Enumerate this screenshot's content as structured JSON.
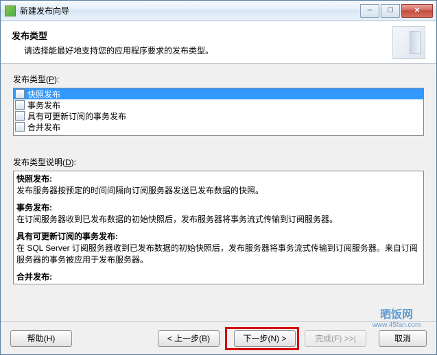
{
  "window": {
    "title": "新建发布向导"
  },
  "banner": {
    "title": "发布类型",
    "subtitle": "请选择能最好地支持您的应用程序要求的发布类型。"
  },
  "types": {
    "label_pre": "发布类型(",
    "label_acc": "P",
    "label_post": "):",
    "items": [
      {
        "label": "快照发布",
        "selected": true
      },
      {
        "label": "事务发布",
        "selected": false
      },
      {
        "label": "具有可更新订阅的事务发布",
        "selected": false
      },
      {
        "label": "合并发布",
        "selected": false
      }
    ]
  },
  "desc": {
    "label_pre": "发布类型说明(",
    "label_acc": "D",
    "label_post": "):",
    "sections": [
      {
        "title": "快照发布:",
        "body": "发布服务器按预定的时间间隔向订阅服务器发送已发布数据的快照。"
      },
      {
        "title": "事务发布:",
        "body": "在订阅服务器收到已发布数据的初始快照后，发布服务器将事务流式传输到订阅服务器。"
      },
      {
        "title": "具有可更新订阅的事务发布:",
        "body": "在 SQL Server 订阅服务器收到已发布数据的初始快照后，发布服务器将事务流式传输到订阅服务器。来自订阅服务器的事务被应用于发布服务器。"
      },
      {
        "title": "合并发布:",
        "body": ""
      }
    ]
  },
  "buttons": {
    "help": "帮助(H)",
    "back": "< 上一步(B)",
    "next": "下一步(N) >",
    "finish": "完成(F) >>|",
    "cancel": "取消"
  },
  "watermark": {
    "logo": "晒饭网",
    "url": "www.45fan.com"
  }
}
